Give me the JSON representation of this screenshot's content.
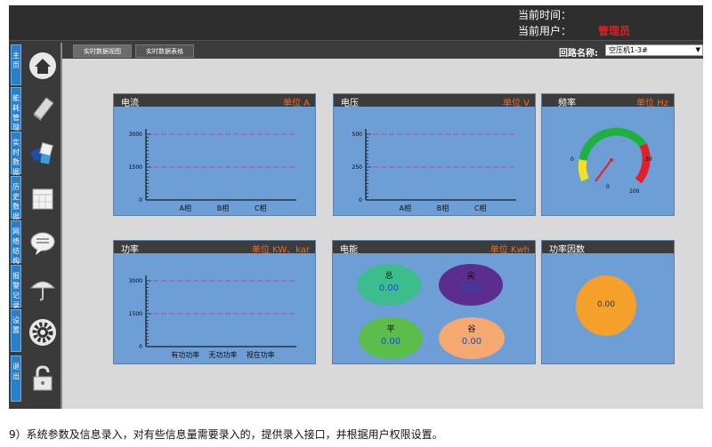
{
  "header": {
    "time_label": "当前时间：",
    "user_label": "当前用户：",
    "user_name": "管理员"
  },
  "sidebar": {
    "items": [
      {
        "label": "主页",
        "icon": "home-icon"
      },
      {
        "label": "能耗管理",
        "icon": "book-icon"
      },
      {
        "label": "实时数据",
        "icon": "cubes-icon"
      },
      {
        "label": "历史数据",
        "icon": "calendar-icon"
      },
      {
        "label": "网络结构",
        "icon": "chat-bubble-icon"
      },
      {
        "label": "报警记录",
        "icon": "umbrella-icon"
      },
      {
        "label": "设置",
        "icon": "gear-icon"
      },
      {
        "label": "退出",
        "icon": "unlock-icon"
      }
    ]
  },
  "tabs": [
    {
      "label": "实时数据视图",
      "active": true
    },
    {
      "label": "实时数据表格",
      "active": false
    }
  ],
  "circuit": {
    "label": "回路名称:",
    "value": "空压机1-3#"
  },
  "panels": {
    "current": {
      "title": "电流",
      "unit": "单位 A"
    },
    "voltage": {
      "title": "电压",
      "unit": "单位 V"
    },
    "frequency": {
      "title": "频率",
      "unit": "单位 Hz"
    },
    "power": {
      "title": "功率",
      "unit": "单位 KW、kar"
    },
    "energy": {
      "title": "电能",
      "unit": "单位 Kwh"
    },
    "power_factor": {
      "title": "功率因数",
      "value": "0.00"
    }
  },
  "energy_items": [
    {
      "label": "总",
      "value": "0.00",
      "color": "#3dbd8e"
    },
    {
      "label": "尖",
      "value": "0.00",
      "color": "#5b2d8f"
    },
    {
      "label": "平",
      "value": "0.00",
      "color": "#5bbd4a"
    },
    {
      "label": "谷",
      "value": "0.00",
      "color": "#f5a870"
    }
  ],
  "gauge": {
    "tick_left": "0",
    "tick_right": "30",
    "tick_bottom_left": "0",
    "tick_bottom_right": "100",
    "segment_colors": [
      "#f0e02a",
      "#20b040",
      "#e0202a"
    ]
  },
  "chart_data": [
    {
      "type": "line",
      "title": "电流",
      "categories": [
        "A相",
        "B相",
        "C相"
      ],
      "y_ticks": [
        "0",
        "1500",
        "3000"
      ],
      "ylim": [
        0,
        3000
      ],
      "reference_lines": [
        3000,
        1500
      ]
    },
    {
      "type": "line",
      "title": "电压",
      "categories": [
        "A相",
        "B相",
        "C相"
      ],
      "y_ticks": [
        "0",
        "250",
        "500"
      ],
      "ylim": [
        0,
        500
      ],
      "reference_lines": [
        500,
        250
      ]
    },
    {
      "type": "line",
      "title": "功率",
      "categories": [
        "有功功率",
        "无功功率",
        "视在功率"
      ],
      "y_ticks": [
        "0",
        "1500",
        "3000"
      ],
      "ylim": [
        0,
        3000
      ],
      "reference_lines": [
        3000,
        1500
      ]
    }
  ],
  "caption": "9）系统参数及信息录入，对有些信息量需要录入的，提供录入接口，并根据用户权限设置。"
}
